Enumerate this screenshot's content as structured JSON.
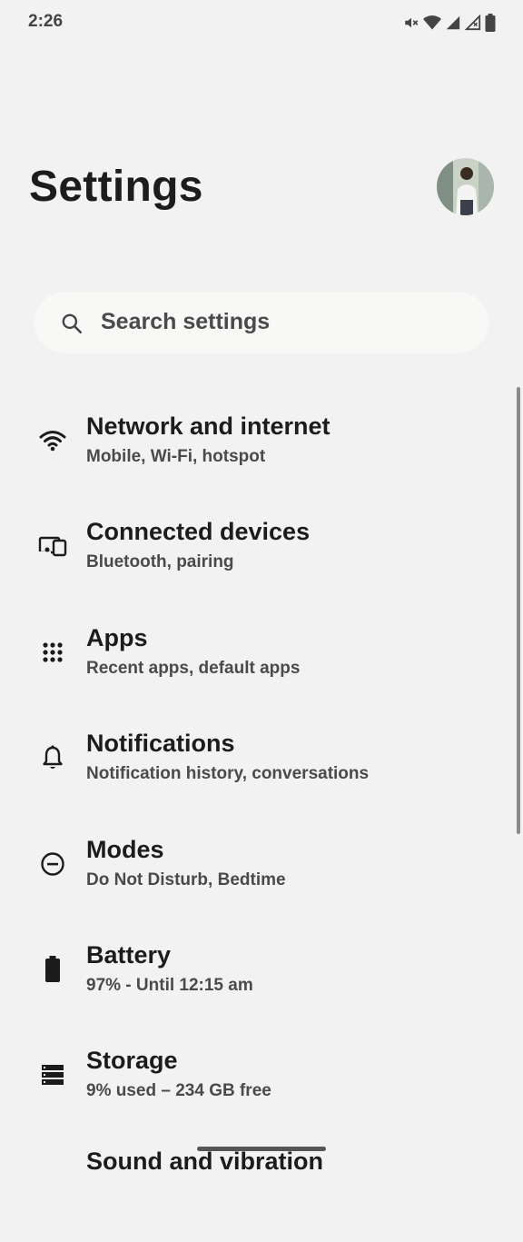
{
  "status_bar": {
    "time": "2:26",
    "icons": [
      "mute-vibrate-icon",
      "wifi-icon",
      "signal-icon",
      "signal-no-data-icon",
      "battery-icon"
    ]
  },
  "header": {
    "title": "Settings",
    "avatar_icon": "profile-avatar"
  },
  "search": {
    "placeholder": "Search settings",
    "icon": "search-icon"
  },
  "settings_items": [
    {
      "id": "network",
      "icon": "wifi-icon",
      "title": "Network and internet",
      "subtitle": "Mobile, Wi-Fi, hotspot"
    },
    {
      "id": "connected-devices",
      "icon": "devices-icon",
      "title": "Connected devices",
      "subtitle": "Bluetooth, pairing"
    },
    {
      "id": "apps",
      "icon": "apps-grid-icon",
      "title": "Apps",
      "subtitle": "Recent apps, default apps"
    },
    {
      "id": "notifications",
      "icon": "bell-icon",
      "title": "Notifications",
      "subtitle": "Notification history, conversations"
    },
    {
      "id": "modes",
      "icon": "do-not-disturb-icon",
      "title": "Modes",
      "subtitle": "Do Not Disturb, Bedtime"
    },
    {
      "id": "battery",
      "icon": "battery-icon",
      "title": "Battery",
      "subtitle": "97% - Until 12:15 am"
    },
    {
      "id": "storage",
      "icon": "storage-icon",
      "title": "Storage",
      "subtitle": "9% used – 234 GB free"
    },
    {
      "id": "sound",
      "icon": "sound-icon",
      "title": "Sound and vibration",
      "subtitle": ""
    }
  ],
  "colors": {
    "background": "#f2f2f2",
    "search_background": "#f8f8f6",
    "text_primary": "#1c1c1c",
    "text_secondary": "#4a4a4a"
  }
}
